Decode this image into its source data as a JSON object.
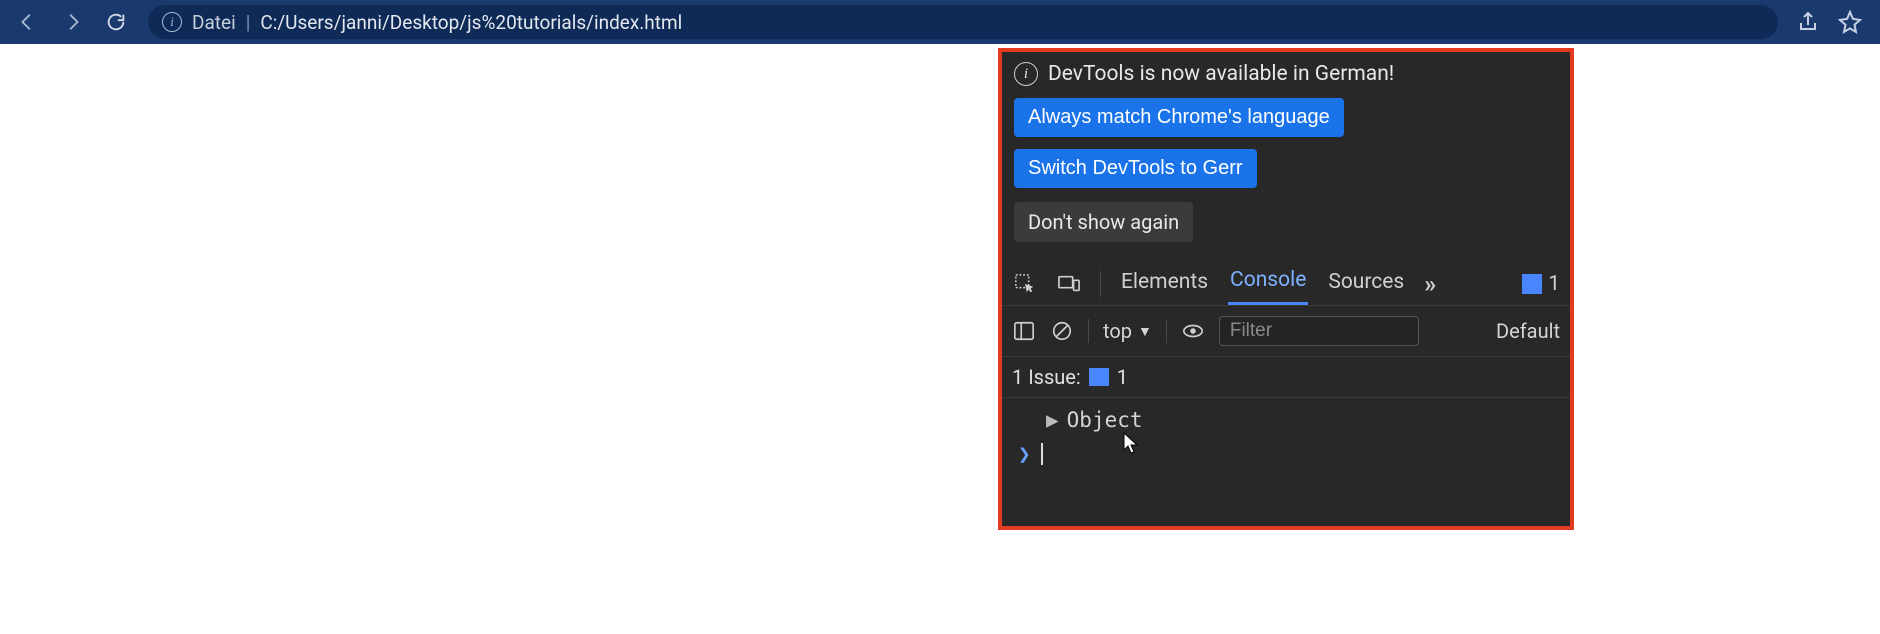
{
  "browser": {
    "addr_label": "Datei",
    "addr_separator": "|",
    "addr_path": "C:/Users/janni/Desktop/js%20tutorials/index.html"
  },
  "devtools": {
    "info_banner": {
      "text": "DevTools is now available in German!",
      "btn_always": "Always match Chrome's language",
      "btn_switch": "Switch DevTools to Gerr",
      "btn_dismiss": "Don't show again"
    },
    "tabs": {
      "elements": "Elements",
      "console": "Console",
      "sources": "Sources",
      "more": "»",
      "trail_count": "1"
    },
    "console_toolbar": {
      "context": "top",
      "filter_placeholder": "Filter",
      "levels": "Default"
    },
    "issues": {
      "label": "1 Issue:",
      "count": "1"
    },
    "console_output": {
      "object_label": "Object"
    }
  }
}
